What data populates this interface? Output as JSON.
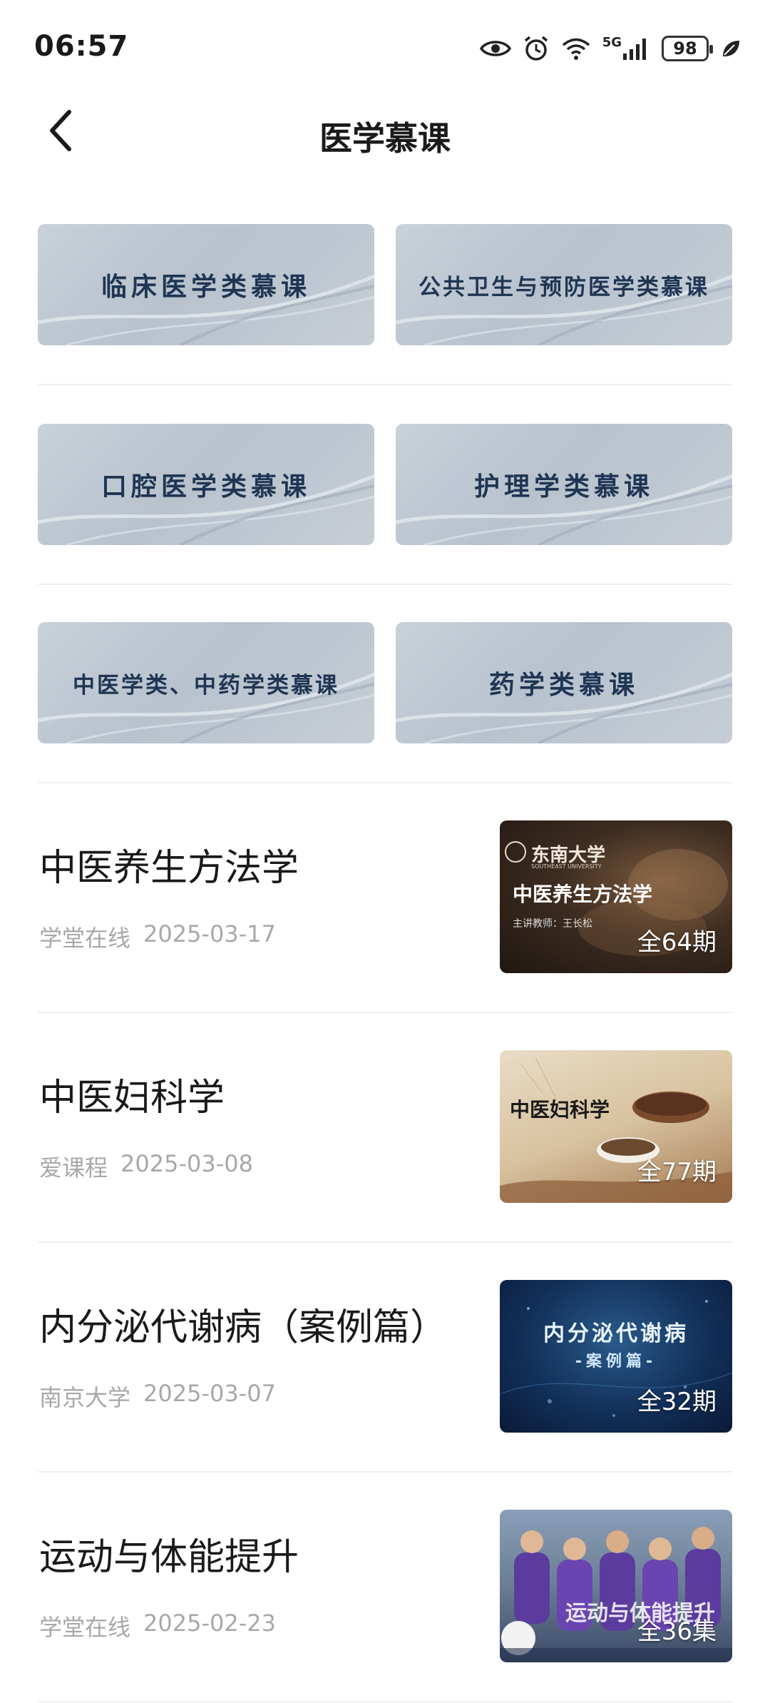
{
  "status_bar": {
    "time": "06:57",
    "battery": "98",
    "network": "5G",
    "network_sim": "6",
    "icons": [
      "eye-icon",
      "alarm-icon",
      "wifi-icon",
      "signal-icon",
      "battery-icon",
      "leaf-icon"
    ]
  },
  "header": {
    "title": "医学慕课",
    "back_icon": "chevron-left-icon"
  },
  "categories": [
    {
      "label": "临床医学类慕课"
    },
    {
      "label": "公共卫生与预防医学类慕课"
    },
    {
      "label": "口腔医学类慕课"
    },
    {
      "label": "护理学类慕课"
    },
    {
      "label": "中医学类、中药学类慕课"
    },
    {
      "label": "药学类慕课"
    }
  ],
  "courses": [
    {
      "title": "中医养生方法学",
      "source": "学堂在线",
      "date": "2025-03-17",
      "count": "全64期",
      "thumb_logo": "东南大学",
      "thumb_logo_en": "SOUTHEAST UNIVERSITY",
      "thumb_title": "中医养生方法学",
      "thumb_sub": "主讲教师：王长松"
    },
    {
      "title": "中医妇科学",
      "source": "爱课程",
      "date": "2025-03-08",
      "count": "全77期",
      "thumb_title": "中医妇科学"
    },
    {
      "title": "内分泌代谢病（案例篇）",
      "source": "南京大学",
      "date": "2025-03-07",
      "count": "全32期",
      "thumb_title": "内分泌代谢病",
      "thumb_sub": "-案例篇-"
    },
    {
      "title": "运动与体能提升",
      "source": "学堂在线",
      "date": "2025-02-23",
      "count": "全36集",
      "thumb_title": "运动与体能提升"
    }
  ],
  "colors": {
    "category_bg": "#c2cad4",
    "category_text": "#1f3553",
    "meta_text": "#a8a8a8",
    "divider": "#efefef"
  }
}
